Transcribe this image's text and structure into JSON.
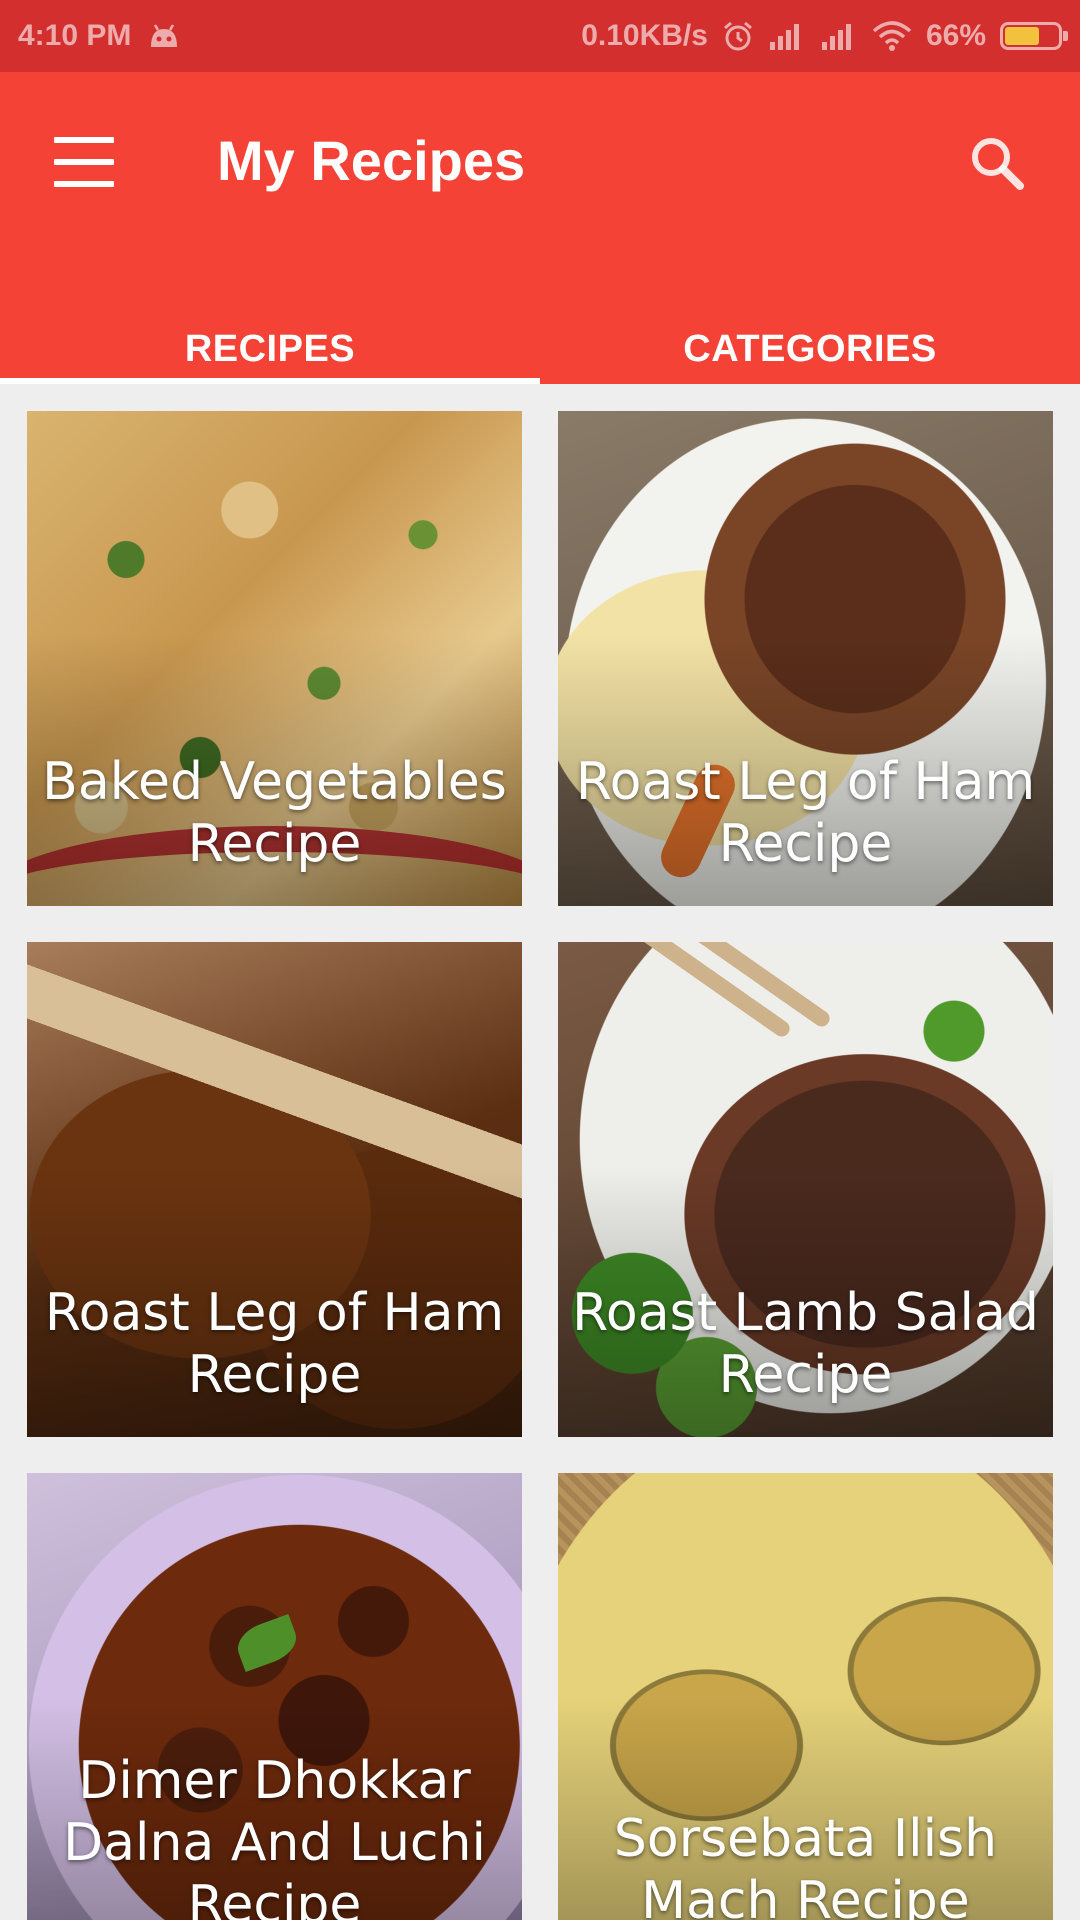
{
  "status_bar": {
    "time": "4:10 PM",
    "network_speed": "0.10KB/s",
    "battery": "66%",
    "battery_level": 0.66,
    "icons": [
      "android-debug-icon",
      "alarm-icon",
      "signal-icon",
      "signal-icon",
      "wifi-icon",
      "battery-charging-icon"
    ]
  },
  "app_bar": {
    "title": "My Recipes",
    "menu_icon": "menu-icon",
    "search_icon": "search-icon",
    "color": "#f44336",
    "status_color": "#d32f2f"
  },
  "tabs": [
    {
      "label": "RECIPES",
      "active": true
    },
    {
      "label": "CATEGORIES",
      "active": false
    }
  ],
  "recipes": [
    {
      "title": "Baked Vegetables Recipe"
    },
    {
      "title": "Roast Leg of Ham Recipe"
    },
    {
      "title": "Roast Leg of Ham Recipe"
    },
    {
      "title": "Roast Lamb Salad Recipe"
    },
    {
      "title": "Dimer Dhokkar Dalna And Luchi Recipe"
    },
    {
      "title": "Sorsebata Ilish Mach Recipe"
    }
  ]
}
